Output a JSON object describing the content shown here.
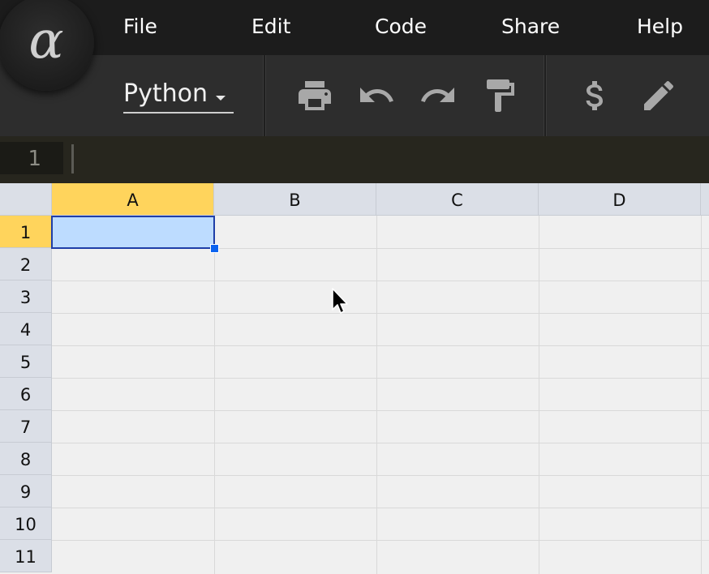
{
  "app": {
    "logo_glyph": "α"
  },
  "menu": {
    "items": [
      {
        "label": "File",
        "name": "menu-file"
      },
      {
        "label": "Edit",
        "name": "menu-edit"
      },
      {
        "label": "Code",
        "name": "menu-code"
      },
      {
        "label": "Share",
        "name": "menu-share"
      },
      {
        "label": "Help",
        "name": "menu-help"
      }
    ]
  },
  "toolbar": {
    "language": {
      "selected": "Python",
      "caret_icon": "caret-down-icon"
    },
    "buttons": [
      {
        "icon": "print-icon",
        "action": "print"
      },
      {
        "icon": "undo-icon",
        "action": "undo"
      },
      {
        "icon": "redo-icon",
        "action": "redo"
      },
      {
        "icon": "paint-format-icon",
        "action": "paint-format"
      },
      {
        "icon": "dollar-icon",
        "action": "currency"
      },
      {
        "icon": "pencil-icon",
        "action": "edit"
      }
    ]
  },
  "code_editor": {
    "line_number": "1",
    "content": ""
  },
  "grid": {
    "columns": [
      "A",
      "B",
      "C",
      "D"
    ],
    "rows": [
      "1",
      "2",
      "3",
      "4",
      "5",
      "6",
      "7",
      "8",
      "9",
      "10",
      "11"
    ],
    "selected_cell": "A1",
    "selected_column": "A",
    "selected_row": "1"
  },
  "colors": {
    "menubar_bg": "#1c1c1c",
    "toolbar_bg": "#2d2d2d",
    "codebar_bg": "#27261e",
    "header_bg": "#dbdfe7",
    "header_active": "#ffd45c",
    "selection_fill": "#bddcff",
    "selection_border": "#1f3ea8",
    "fill_handle": "#0b63f0",
    "icon_color": "#a8a8a8"
  }
}
